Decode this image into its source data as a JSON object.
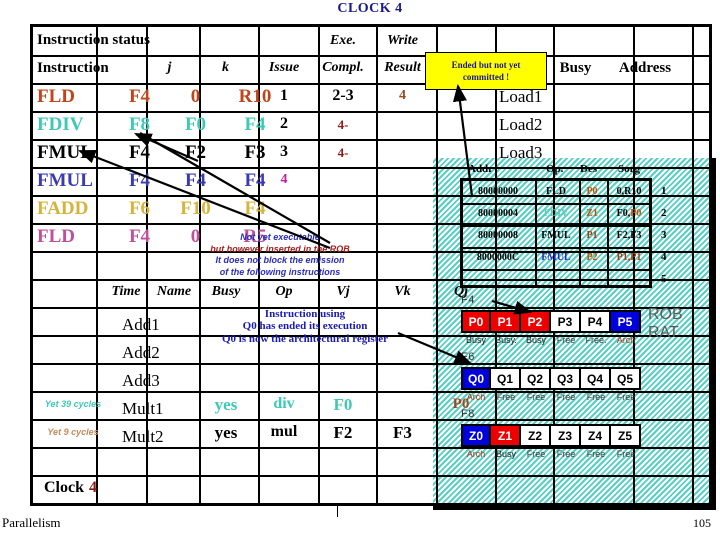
{
  "slide": {
    "title": "CLOCK 4",
    "footer_left": "Parallelism",
    "page_number": "105"
  },
  "instruction_status": {
    "section_label": "Instruction status",
    "headers": {
      "instruction": "Instruction",
      "j": "j",
      "k": "k",
      "issue": "Issue",
      "exe": "Exe.",
      "compl": "Compl.",
      "write": "Write",
      "result": "Result"
    },
    "rows": [
      {
        "op": "FLD",
        "j": "F4",
        "k": "0",
        "dest": "R10",
        "issue": "1",
        "compl": "2-3",
        "result": "4",
        "color": "c-fld1"
      },
      {
        "op": "FDIV",
        "j": "F8",
        "k": "F0",
        "dest": "F4",
        "issue": "2",
        "compl": "4-",
        "result": "",
        "color": "c-fdiv"
      },
      {
        "op": "FMUL",
        "j": "F4",
        "k": "F2",
        "dest": "F3",
        "issue": "3",
        "compl": "4-",
        "result": "",
        "color": "c-fmul1"
      },
      {
        "op": "FMUL",
        "j": "F4",
        "k": "F4",
        "dest": "F4",
        "issue": "4",
        "compl": "",
        "result": "",
        "color": "c-fmul2"
      },
      {
        "op": "FADD",
        "j": "F6",
        "k": "F10",
        "dest": "F4",
        "issue": "",
        "compl": "",
        "result": "",
        "color": "c-fadd"
      },
      {
        "op": "FLD",
        "j": "F4",
        "k": "0",
        "dest": "R5",
        "issue": "",
        "compl": "",
        "result": "",
        "color": "c-fld2"
      }
    ]
  },
  "load_unit": {
    "busy_header": "Busy",
    "address_header": "Address",
    "names": [
      "Load1",
      "Load2",
      "Load3"
    ]
  },
  "reservation_stations": {
    "headers": {
      "time": "Time",
      "name": "Name",
      "busy": "Busy",
      "op": "Op",
      "vj": "Vj",
      "vk": "Vk",
      "qj": "Qj"
    },
    "rows": [
      {
        "time": "",
        "name": "Add1",
        "busy": "",
        "op": "",
        "vj": "",
        "vk": "",
        "qj": "",
        "color": "c-black"
      },
      {
        "time": "",
        "name": "Add2",
        "busy": "",
        "op": "",
        "vj": "",
        "vk": "",
        "qj": "",
        "color": "c-black"
      },
      {
        "time": "",
        "name": "Add3",
        "busy": "",
        "op": "",
        "vj": "",
        "vk": "",
        "qj": "",
        "color": "c-black"
      },
      {
        "time": "Yet 39 cycles",
        "name": "Mult1",
        "busy": "yes",
        "op": "div",
        "vj": "F0",
        "vk": "",
        "qj": "P0",
        "color": "c-fdiv"
      },
      {
        "time": "Yet 9 cycles",
        "name": "Mult2",
        "busy": "yes",
        "op": "mul",
        "vj": "F2",
        "vk": "F3",
        "qj": "",
        "color": "c-black"
      }
    ],
    "clock_label": "Clock",
    "clock_value": "4"
  },
  "callout": {
    "line1": "Ended but not yet",
    "line2": "committed !",
    "bg": "#ffff00",
    "text_color": "#1a1a8c"
  },
  "annotations": {
    "rob_note": [
      {
        "text": "Not yet executable",
        "color": "#2b2bbd"
      },
      {
        "text": "but however inserted in the ROB",
        "color": "#a02020"
      },
      {
        "text": "It does not block the emission",
        "color": "#2b2bbd"
      },
      {
        "text": "of the following instructions",
        "color": "#2b2bbd"
      }
    ],
    "q0_note": [
      "Instruction using",
      "Q0 has ended its execution",
      "Q0  is now the architectural register"
    ]
  },
  "rob": {
    "headers": [
      "Addr",
      "Op.",
      "Des",
      "Sorg"
    ],
    "rows": [
      {
        "addr": "80000000",
        "op": "FLD",
        "op_color": "#000000",
        "des": "P0",
        "des_color": "#c05000",
        "sorg": "0,R10",
        "sorg_html": "0,R10",
        "idx": "1"
      },
      {
        "addr": "80000004",
        "op": "FDIV",
        "op_color": "#5fc9b4",
        "des": "Z1",
        "des_color": "#c05000",
        "sorg": "F0,P0",
        "sorg_html": "F0,P0",
        "idx": "2"
      },
      {
        "addr": "80000008",
        "op": "FMUL",
        "op_color": "#000000",
        "des": "P1",
        "des_color": "#a03c10",
        "sorg": "F2,F3",
        "sorg_html": "F2,F3",
        "idx": "3"
      },
      {
        "addr": "8000000C",
        "op": "FMUL",
        "op_color": "#2b2bbd",
        "des": "P2",
        "des_color": "#c05000",
        "sorg": "P1,P1",
        "sorg_html": "P1,P1",
        "idx": "4"
      },
      {
        "addr": "",
        "op": "",
        "op_color": "#000000",
        "des": "",
        "des_color": "#000000",
        "sorg": "",
        "sorg_html": "",
        "idx": "5"
      }
    ]
  },
  "rat": {
    "label": "ROB\nRAT",
    "label_line1": "ROB",
    "label_line2": "RAT",
    "banks": [
      {
        "register": "F4",
        "entries": [
          {
            "name": "P0",
            "state": "Busy",
            "style": "rb-red"
          },
          {
            "name": "P1",
            "state": "Busy.",
            "style": "rb-red"
          },
          {
            "name": "P2",
            "state": "Busy",
            "style": "rb-red"
          },
          {
            "name": "P3",
            "state": "Free",
            "style": "rb-white"
          },
          {
            "name": "P4",
            "state": "Free.",
            "style": "rb-white"
          },
          {
            "name": "P5",
            "state": "Arch",
            "style": "rb-blue"
          }
        ]
      },
      {
        "register": "F6",
        "entries": [
          {
            "name": "Q0",
            "state": "Arch",
            "style": "rb-blue"
          },
          {
            "name": "Q1",
            "state": "Free",
            "style": "rb-white"
          },
          {
            "name": "Q2",
            "state": "Free",
            "style": "rb-white"
          },
          {
            "name": "Q3",
            "state": "Free",
            "style": "rb-white"
          },
          {
            "name": "Q4",
            "state": "Free",
            "style": "rb-white"
          },
          {
            "name": "Q5",
            "state": "Free",
            "style": "rb-white"
          }
        ]
      },
      {
        "register": "F8",
        "entries": [
          {
            "name": "Z0",
            "state": "Arch",
            "style": "rb-blue"
          },
          {
            "name": "Z1",
            "state": "Busy",
            "style": "rb-red"
          },
          {
            "name": "Z2",
            "state": "Free",
            "style": "rb-white"
          },
          {
            "name": "Z3",
            "state": "Free",
            "style": "rb-white"
          },
          {
            "name": "Z4",
            "state": "Free",
            "style": "rb-white"
          },
          {
            "name": "Z5",
            "state": "Free",
            "style": "rb-white"
          }
        ]
      }
    ]
  }
}
